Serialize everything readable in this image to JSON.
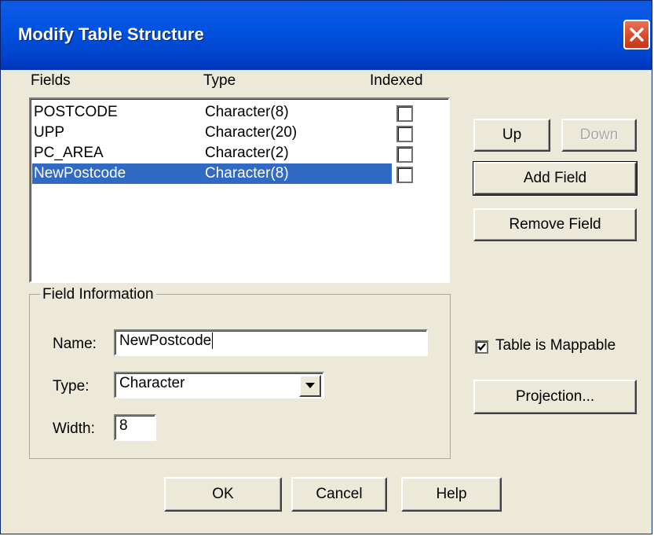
{
  "window": {
    "title": "Modify Table Structure"
  },
  "fields_list": {
    "headers": {
      "fields": "Fields",
      "type": "Type",
      "indexed": "Indexed"
    },
    "rows": [
      {
        "name": "POSTCODE",
        "type": "Character(8)",
        "indexed": false,
        "selected": false
      },
      {
        "name": "UPP",
        "type": "Character(20)",
        "indexed": false,
        "selected": false
      },
      {
        "name": "PC_AREA",
        "type": "Character(2)",
        "indexed": false,
        "selected": false
      },
      {
        "name": "NewPostcode",
        "type": "Character(8)",
        "indexed": false,
        "selected": true
      }
    ]
  },
  "buttons": {
    "up": "Up",
    "down": "Down",
    "add_field": "Add Field",
    "remove_field": "Remove Field",
    "projection": "Projection...",
    "ok": "OK",
    "cancel": "Cancel",
    "help": "Help"
  },
  "field_info": {
    "group_label": "Field Information",
    "name_label": "Name:",
    "name_value": "NewPostcode",
    "type_label": "Type:",
    "type_value": "Character",
    "width_label": "Width:",
    "width_value": "8"
  },
  "mappable": {
    "label": "Table is Mappable",
    "checked": true
  },
  "colors": {
    "selection": "#316ac5",
    "dialog_bg": "#ece9d8",
    "titlebar": "#0053e1"
  },
  "icons": {
    "close": "close-icon",
    "dropdown": "chevron-down-icon",
    "check": "checkmark-icon"
  }
}
